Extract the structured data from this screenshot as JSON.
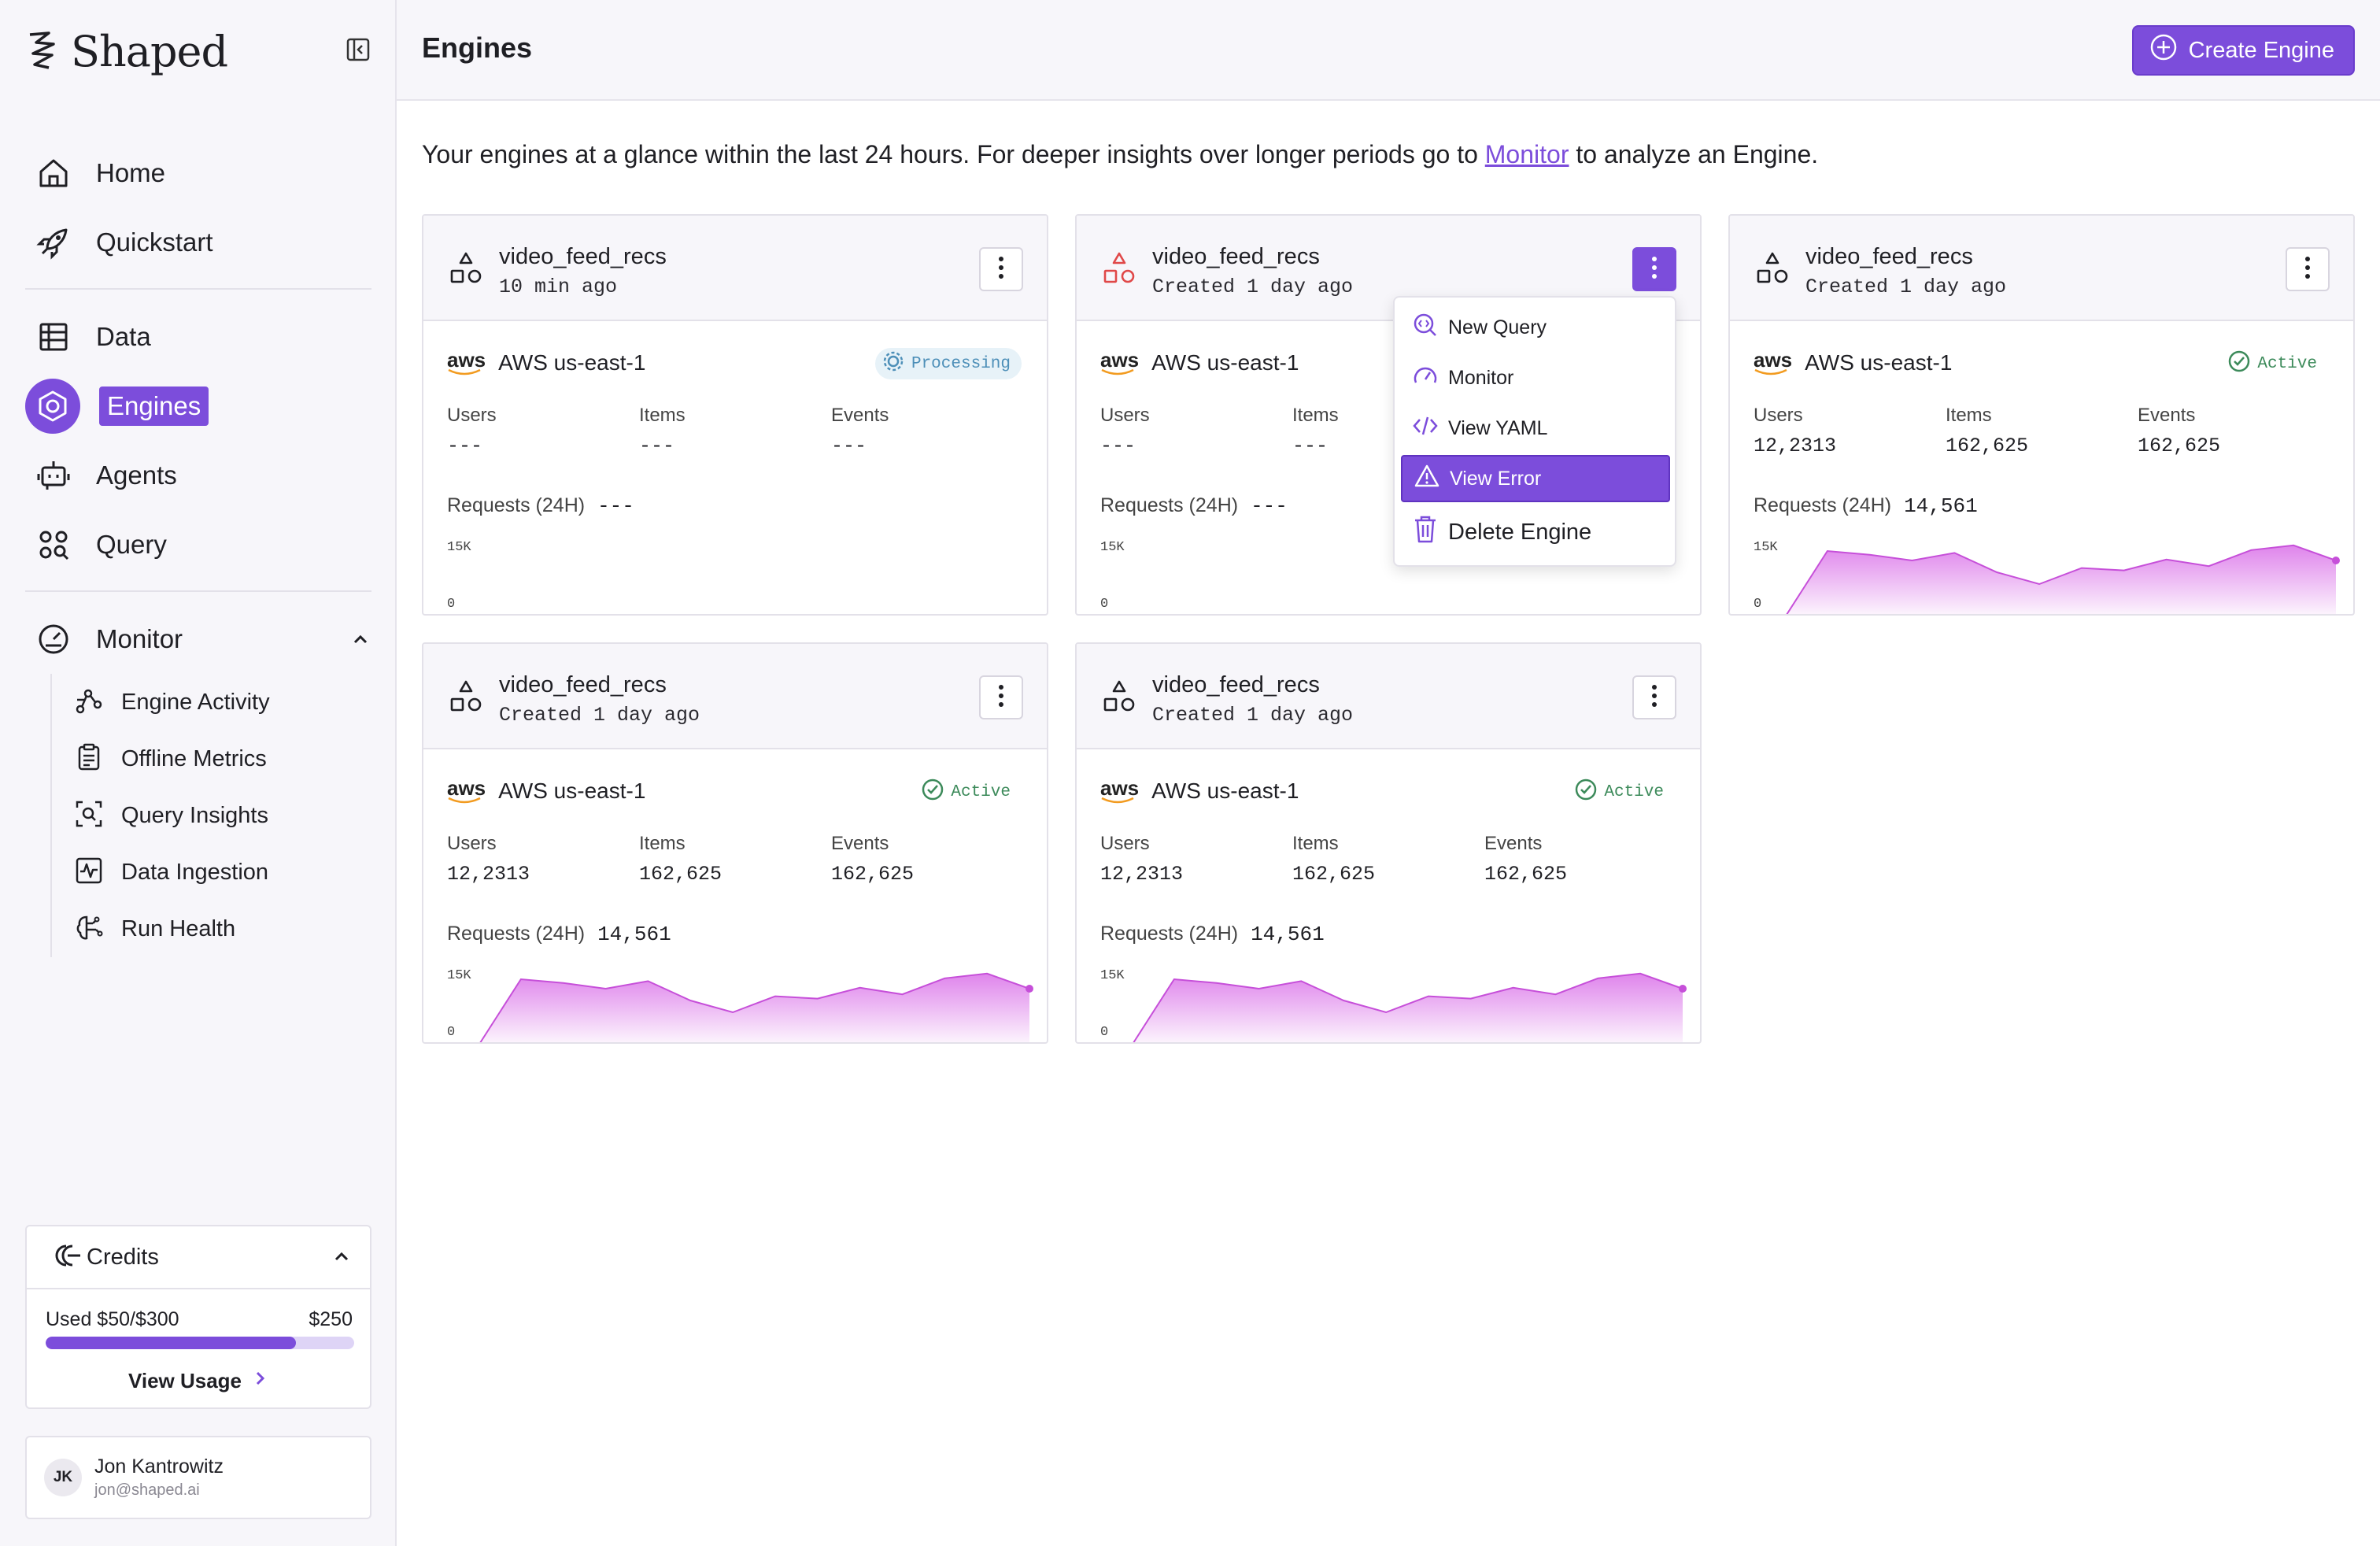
{
  "app": {
    "name": "Shaped"
  },
  "sidebar": {
    "nav": [
      {
        "label": "Home",
        "icon": "home-icon"
      },
      {
        "label": "Quickstart",
        "icon": "rocket-icon"
      },
      {
        "label": "Data",
        "icon": "table-icon"
      },
      {
        "label": "Engines",
        "icon": "engine-hexagon-icon",
        "active": true
      },
      {
        "label": "Agents",
        "icon": "robot-icon"
      },
      {
        "label": "Query",
        "icon": "query-dots-icon"
      },
      {
        "label": "Monitor",
        "icon": "gauge-icon",
        "expanded": true
      }
    ],
    "monitor_items": [
      {
        "label": "Engine Activity",
        "icon": "activity-graph-icon"
      },
      {
        "label": "Offline Metrics",
        "icon": "clipboard-icon"
      },
      {
        "label": "Query Insights",
        "icon": "scan-search-icon"
      },
      {
        "label": "Data Ingestion",
        "icon": "pulse-chart-icon"
      },
      {
        "label": "Run Health",
        "icon": "brain-icon"
      }
    ],
    "credits": {
      "title": "Credits",
      "used_label": "Used $50/$300",
      "remaining": "$250",
      "used_fraction": 0.81,
      "view_usage": "View Usage"
    },
    "user": {
      "initials": "JK",
      "name": "Jon Kantrowitz",
      "email": "jon@shaped.ai"
    }
  },
  "header": {
    "title": "Engines",
    "create_button": "Create Engine"
  },
  "intro": {
    "before": "Your engines at a glance within the last 24 hours.  For deeper insights over longer periods go to ",
    "link": "Monitor",
    "after": " to analyze an Engine."
  },
  "labels": {
    "users": "Users",
    "items": "Items",
    "events": "Events",
    "requests": "Requests (24H)",
    "axis_max": "15K",
    "axis_min": "0",
    "region": "AWS us-east-1",
    "aws": "aws"
  },
  "engines": [
    {
      "name": "video_feed_recs",
      "time": "10 min ago",
      "status": "Processing",
      "users": "---",
      "items": "---",
      "events": "---",
      "requests": "---",
      "error": false,
      "series": []
    },
    {
      "name": "video_feed_recs",
      "time": "Created 1 day ago",
      "status": "",
      "users": "---",
      "items": "---",
      "events": "",
      "requests": "---",
      "error": true,
      "series": []
    },
    {
      "name": "video_feed_recs",
      "time": "Created 1 day ago",
      "status": "Active",
      "users": "12,2313",
      "items": "162,625",
      "events": "162,625",
      "requests": "14,561",
      "error": false,
      "series": [
        0,
        14000,
        13200,
        12000,
        13600,
        9500,
        7000,
        10400,
        9900,
        12200,
        10800,
        14200,
        15200,
        12000
      ]
    },
    {
      "name": "video_feed_recs",
      "time": "Created 1 day ago",
      "status": "Active",
      "users": "12,2313",
      "items": "162,625",
      "events": "162,625",
      "requests": "14,561",
      "error": false,
      "series": [
        0,
        14000,
        13200,
        12000,
        13600,
        9500,
        7000,
        10400,
        9900,
        12200,
        10800,
        14200,
        15200,
        12000
      ]
    },
    {
      "name": "video_feed_recs",
      "time": "Created 1 day ago",
      "status": "Active",
      "users": "12,2313",
      "items": "162,625",
      "events": "162,625",
      "requests": "14,561",
      "error": false,
      "series": [
        0,
        14000,
        13200,
        12000,
        13600,
        9500,
        7000,
        10400,
        9900,
        12200,
        10800,
        14200,
        15200,
        12000
      ]
    }
  ],
  "context_menu": {
    "items": [
      {
        "label": "New Query",
        "icon": "query-search-icon"
      },
      {
        "label": "Monitor",
        "icon": "gauge-icon"
      },
      {
        "label": "View YAML",
        "icon": "code-icon"
      },
      {
        "label": "View Error",
        "icon": "warning-icon",
        "highlighted": true
      },
      {
        "label": "Delete Engine",
        "icon": "trash-icon"
      }
    ]
  },
  "colors": {
    "accent": "#7c4ddb",
    "error": "#e04848",
    "active": "#3c8a5a",
    "processing": "#4d8fb8",
    "chart_fill": "#d96ee8"
  }
}
